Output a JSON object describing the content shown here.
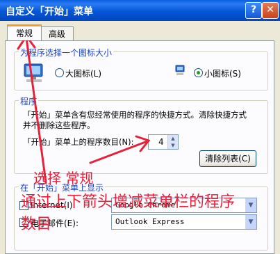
{
  "window": {
    "title": "自定义「开始」菜单",
    "help_glyph": "?",
    "close_glyph": "✕"
  },
  "tabs": [
    {
      "label": "常规",
      "selected": true
    },
    {
      "label": "高级",
      "selected": false
    }
  ],
  "icon_size": {
    "group_title": "为程序选择一个图标大小",
    "large_label": "大图标(L)",
    "small_label": "小图标(S)",
    "selected": "small"
  },
  "programs": {
    "group_title": "程序",
    "description_line1": "「开始」菜单含有您经常使用的程序的快捷方式。清除快捷方式",
    "description_line2": "并不删除这些程序。",
    "count_label": "「开始」菜单上的程序数目(N):",
    "count_value": "4",
    "clear_button": "清除列表(C)"
  },
  "show_on_start": {
    "group_title": "在「开始」菜单上显示",
    "internet_label": "Internet(I):",
    "internet_value": "Google Chrome",
    "email_label": "电子邮件(E):",
    "email_value": "Outlook Express"
  },
  "annotation": {
    "line1": "选择 常规",
    "line2": "通过上下箭头增减菜单栏的程序",
    "line3": "数目",
    "color": "#e8203a"
  }
}
